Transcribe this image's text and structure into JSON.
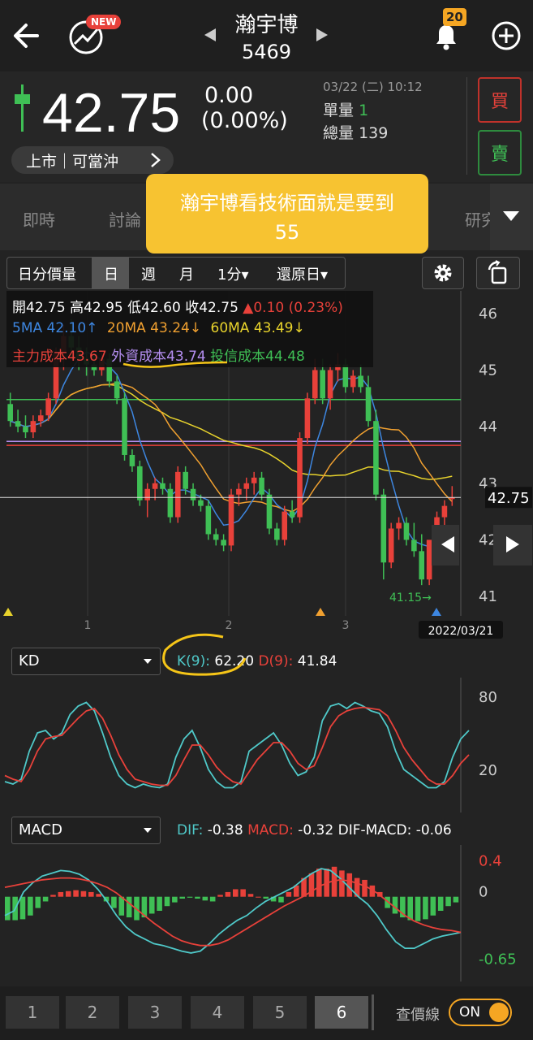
{
  "header": {
    "stock_name": "瀚宇博",
    "stock_code": "5469",
    "new_badge": "NEW",
    "notification_count": "20"
  },
  "quote": {
    "price": "42.75",
    "change": "0.00",
    "change_pct": "(0.00%)",
    "datetime": "03/22 (二) 10:12",
    "single_vol_label": "單量",
    "single_vol": "1",
    "total_vol_label": "總量",
    "total_vol": "139",
    "buy_label": "買",
    "sell_label": "賣",
    "market_tag": "上市｜可當沖"
  },
  "tabs": [
    "即時",
    "討論",
    "研究"
  ],
  "tooltip": {
    "line1": "瀚宇博看技術面就是要到",
    "line2": "55"
  },
  "toolbar": {
    "items": [
      "日分價量",
      "日",
      "週",
      "月",
      "1分",
      "還原日"
    ],
    "selected": "日"
  },
  "info": {
    "ohlc": "開42.75 高42.95 低42.60 收42.75",
    "delta": "▲0.10 (0.23%)",
    "ma5": "5MA 42.10↑",
    "ma20": "20MA 43.24↓",
    "ma60": "60MA 43.49↓",
    "cost_main": "主力成本43.67",
    "cost_foreign": "外資成本43.74",
    "cost_trust": "投信成本44.48"
  },
  "kd": {
    "selector": "KD",
    "k_label": "K(9):",
    "k_value": "62.20",
    "d_label": "D(9):",
    "d_value": "41.84"
  },
  "macd": {
    "selector": "MACD",
    "dif_label": "DIF:",
    "dif_value": "-0.38",
    "macd_label": "MACD:",
    "macd_value": "-0.32",
    "osc_label": "DIF-MACD:",
    "osc_value": "-0.06"
  },
  "bottom": {
    "pages": [
      "1",
      "2",
      "3",
      "4",
      "5",
      "6"
    ],
    "active_page": "6",
    "price_line_label": "查價線",
    "toggle_label": "ON"
  },
  "colors": {
    "up": "#e8413a",
    "down": "#3fbf55",
    "ma5": "#3d86e0",
    "ma20": "#f0a030",
    "ma60": "#e8d32c",
    "foreign": "#b48ef0",
    "trust": "#3fbf55"
  },
  "chart_data": [
    {
      "type": "candlestick",
      "title": "",
      "y_ticks": [
        46,
        45,
        44,
        43,
        42,
        41
      ],
      "ylim": [
        40.8,
        46.4
      ],
      "x_ticks": [
        "1",
        "2",
        "3"
      ],
      "last_price_label": "42.75",
      "low_annotation": "41.15→",
      "date_label": "2022/03/21",
      "candles": [
        {
          "o": 44.4,
          "h": 44.6,
          "l": 44.0,
          "c": 44.1
        },
        {
          "o": 44.1,
          "h": 44.3,
          "l": 43.9,
          "c": 44.0
        },
        {
          "o": 44.0,
          "h": 44.2,
          "l": 43.8,
          "c": 43.9
        },
        {
          "o": 43.9,
          "h": 44.2,
          "l": 43.8,
          "c": 44.1
        },
        {
          "o": 44.1,
          "h": 44.3,
          "l": 44.0,
          "c": 44.2
        },
        {
          "o": 44.2,
          "h": 44.6,
          "l": 44.1,
          "c": 44.5
        },
        {
          "o": 44.5,
          "h": 45.4,
          "l": 44.4,
          "c": 45.3
        },
        {
          "o": 45.3,
          "h": 45.8,
          "l": 45.0,
          "c": 45.6
        },
        {
          "o": 45.6,
          "h": 45.9,
          "l": 45.2,
          "c": 45.4
        },
        {
          "o": 45.4,
          "h": 45.6,
          "l": 45.0,
          "c": 45.2
        },
        {
          "o": 45.2,
          "h": 45.4,
          "l": 44.9,
          "c": 45.1
        },
        {
          "o": 45.1,
          "h": 45.3,
          "l": 44.9,
          "c": 45.0
        },
        {
          "o": 45.0,
          "h": 45.3,
          "l": 44.9,
          "c": 45.2
        },
        {
          "o": 45.2,
          "h": 45.3,
          "l": 44.7,
          "c": 44.8
        },
        {
          "o": 44.8,
          "h": 44.9,
          "l": 44.4,
          "c": 44.5
        },
        {
          "o": 44.5,
          "h": 44.6,
          "l": 43.4,
          "c": 43.5
        },
        {
          "o": 43.5,
          "h": 43.6,
          "l": 43.2,
          "c": 43.3
        },
        {
          "o": 43.3,
          "h": 43.4,
          "l": 42.6,
          "c": 42.7
        },
        {
          "o": 42.7,
          "h": 43.0,
          "l": 42.4,
          "c": 42.9
        },
        {
          "o": 42.9,
          "h": 43.1,
          "l": 42.7,
          "c": 43.0
        },
        {
          "o": 43.0,
          "h": 43.1,
          "l": 42.8,
          "c": 42.9
        },
        {
          "o": 42.9,
          "h": 43.0,
          "l": 42.3,
          "c": 42.4
        },
        {
          "o": 42.4,
          "h": 43.3,
          "l": 42.3,
          "c": 43.2
        },
        {
          "o": 43.2,
          "h": 43.3,
          "l": 42.8,
          "c": 42.9
        },
        {
          "o": 42.9,
          "h": 43.0,
          "l": 42.6,
          "c": 42.7
        },
        {
          "o": 42.7,
          "h": 42.8,
          "l": 42.5,
          "c": 42.6
        },
        {
          "o": 42.6,
          "h": 42.7,
          "l": 42.0,
          "c": 42.1
        },
        {
          "o": 42.1,
          "h": 42.2,
          "l": 41.9,
          "c": 42.0
        },
        {
          "o": 42.0,
          "h": 42.1,
          "l": 41.8,
          "c": 41.9
        },
        {
          "o": 41.9,
          "h": 42.9,
          "l": 41.8,
          "c": 42.8
        },
        {
          "o": 42.8,
          "h": 43.0,
          "l": 42.6,
          "c": 42.9
        },
        {
          "o": 42.9,
          "h": 43.1,
          "l": 42.7,
          "c": 43.0
        },
        {
          "o": 43.0,
          "h": 43.2,
          "l": 42.8,
          "c": 43.1
        },
        {
          "o": 43.1,
          "h": 43.2,
          "l": 42.7,
          "c": 42.8
        },
        {
          "o": 42.8,
          "h": 42.9,
          "l": 42.1,
          "c": 42.2
        },
        {
          "o": 42.2,
          "h": 42.3,
          "l": 41.9,
          "c": 42.0
        },
        {
          "o": 42.0,
          "h": 42.6,
          "l": 41.9,
          "c": 42.5
        },
        {
          "o": 42.5,
          "h": 42.7,
          "l": 42.3,
          "c": 42.4
        },
        {
          "o": 42.4,
          "h": 43.9,
          "l": 42.3,
          "c": 43.8
        },
        {
          "o": 43.8,
          "h": 44.6,
          "l": 43.7,
          "c": 44.5
        },
        {
          "o": 44.5,
          "h": 45.2,
          "l": 44.4,
          "c": 45.0
        },
        {
          "o": 45.0,
          "h": 45.2,
          "l": 44.4,
          "c": 44.5
        },
        {
          "o": 44.5,
          "h": 45.1,
          "l": 44.3,
          "c": 45.0
        },
        {
          "o": 45.0,
          "h": 45.3,
          "l": 44.8,
          "c": 45.1
        },
        {
          "o": 45.1,
          "h": 45.2,
          "l": 44.6,
          "c": 44.7
        },
        {
          "o": 44.7,
          "h": 45.0,
          "l": 44.6,
          "c": 44.9
        },
        {
          "o": 44.9,
          "h": 45.1,
          "l": 44.6,
          "c": 44.7
        },
        {
          "o": 44.7,
          "h": 44.9,
          "l": 44.0,
          "c": 44.1
        },
        {
          "o": 44.1,
          "h": 44.3,
          "l": 42.7,
          "c": 42.8
        },
        {
          "o": 42.8,
          "h": 42.9,
          "l": 41.3,
          "c": 41.6
        },
        {
          "o": 41.6,
          "h": 42.3,
          "l": 41.5,
          "c": 42.2
        },
        {
          "o": 42.2,
          "h": 42.4,
          "l": 42.0,
          "c": 42.3
        },
        {
          "o": 42.3,
          "h": 42.4,
          "l": 41.9,
          "c": 42.0
        },
        {
          "o": 42.0,
          "h": 42.3,
          "l": 41.7,
          "c": 41.8
        },
        {
          "o": 41.8,
          "h": 42.1,
          "l": 41.2,
          "c": 41.3
        },
        {
          "o": 41.3,
          "h": 42.0,
          "l": 41.2,
          "c": 42.0
        },
        {
          "o": 42.0,
          "h": 42.5,
          "l": 41.9,
          "c": 42.4
        },
        {
          "o": 42.4,
          "h": 42.7,
          "l": 42.1,
          "c": 42.6
        },
        {
          "o": 42.75,
          "h": 42.95,
          "l": 42.6,
          "c": 42.75
        }
      ]
    },
    {
      "type": "line",
      "title": "KD",
      "y_ticks": [
        80,
        20
      ],
      "ylim": [
        0,
        100
      ],
      "series": [
        {
          "name": "K(9)",
          "values": [
            20,
            18,
            22,
            45,
            60,
            62,
            55,
            60,
            75,
            82,
            85,
            78,
            60,
            40,
            25,
            18,
            15,
            18,
            16,
            15,
            18,
            40,
            55,
            62,
            48,
            30,
            20,
            15,
            15,
            20,
            45,
            50,
            55,
            60,
            50,
            35,
            25,
            28,
            40,
            70,
            82,
            84,
            80,
            85,
            82,
            78,
            76,
            65,
            45,
            30,
            25,
            20,
            15,
            15,
            20,
            40,
            55,
            62
          ]
        },
        {
          "name": "D(9)",
          "values": [
            25,
            22,
            20,
            30,
            45,
            55,
            57,
            58,
            65,
            72,
            78,
            80,
            72,
            58,
            42,
            30,
            22,
            20,
            18,
            17,
            17,
            25,
            38,
            50,
            50,
            42,
            32,
            25,
            20,
            18,
            28,
            38,
            45,
            52,
            52,
            45,
            35,
            30,
            33,
            48,
            65,
            74,
            78,
            80,
            81,
            80,
            79,
            74,
            62,
            48,
            38,
            30,
            22,
            18,
            18,
            25,
            35,
            42
          ]
        }
      ]
    },
    {
      "type": "bar+line",
      "title": "MACD",
      "y_ticks": [
        0.4,
        0,
        -0.65
      ],
      "ylim": [
        -0.8,
        0.5
      ],
      "osc": [
        -0.25,
        -0.25,
        -0.24,
        -0.2,
        -0.12,
        -0.05,
        0.02,
        0.05,
        0.06,
        0.07,
        0.06,
        0.05,
        0.03,
        -0.05,
        -0.12,
        -0.2,
        -0.22,
        -0.25,
        -0.22,
        -0.18,
        -0.15,
        -0.1,
        -0.06,
        -0.02,
        -0.01,
        -0.02,
        -0.04,
        -0.05,
        0.02,
        0.05,
        0.08,
        0.08,
        0.03,
        0.0,
        -0.02,
        -0.05,
        -0.06,
        0.05,
        0.12,
        0.2,
        0.25,
        0.3,
        0.3,
        0.32,
        0.28,
        0.25,
        0.2,
        0.18,
        0.12,
        0.05,
        -0.12,
        -0.18,
        -0.22,
        -0.25,
        -0.26,
        -0.24,
        -0.2,
        -0.15,
        -0.1,
        -0.06
      ],
      "series": [
        {
          "name": "DIF",
          "values": [
            -0.2,
            -0.15,
            0.05,
            0.15,
            0.22,
            0.25,
            0.28,
            0.27,
            0.24,
            0.18,
            0.08,
            -0.05,
            -0.2,
            -0.32,
            -0.4,
            -0.45,
            -0.5,
            -0.52,
            -0.55,
            -0.58,
            -0.6,
            -0.58,
            -0.5,
            -0.4,
            -0.32,
            -0.25,
            -0.2,
            -0.12,
            -0.05,
            0.0,
            0.05,
            0.1,
            0.18,
            0.25,
            0.3,
            0.28,
            0.2,
            0.1,
            0.0,
            -0.08,
            -0.2,
            -0.35,
            -0.48,
            -0.55,
            -0.55,
            -0.5,
            -0.45,
            -0.42,
            -0.4,
            -0.38
          ]
        },
        {
          "name": "MACD",
          "values": [
            0.1,
            0.12,
            0.14,
            0.16,
            0.18,
            0.19,
            0.2,
            0.2,
            0.19,
            0.17,
            0.14,
            0.1,
            0.04,
            -0.04,
            -0.12,
            -0.2,
            -0.28,
            -0.35,
            -0.42,
            -0.47,
            -0.5,
            -0.52,
            -0.52,
            -0.5,
            -0.46,
            -0.4,
            -0.34,
            -0.28,
            -0.22,
            -0.16,
            -0.1,
            -0.05,
            0.0,
            0.06,
            0.12,
            0.16,
            0.18,
            0.17,
            0.14,
            0.1,
            0.04,
            -0.04,
            -0.12,
            -0.2,
            -0.26,
            -0.3,
            -0.33,
            -0.35,
            -0.36,
            -0.38
          ]
        }
      ]
    }
  ]
}
